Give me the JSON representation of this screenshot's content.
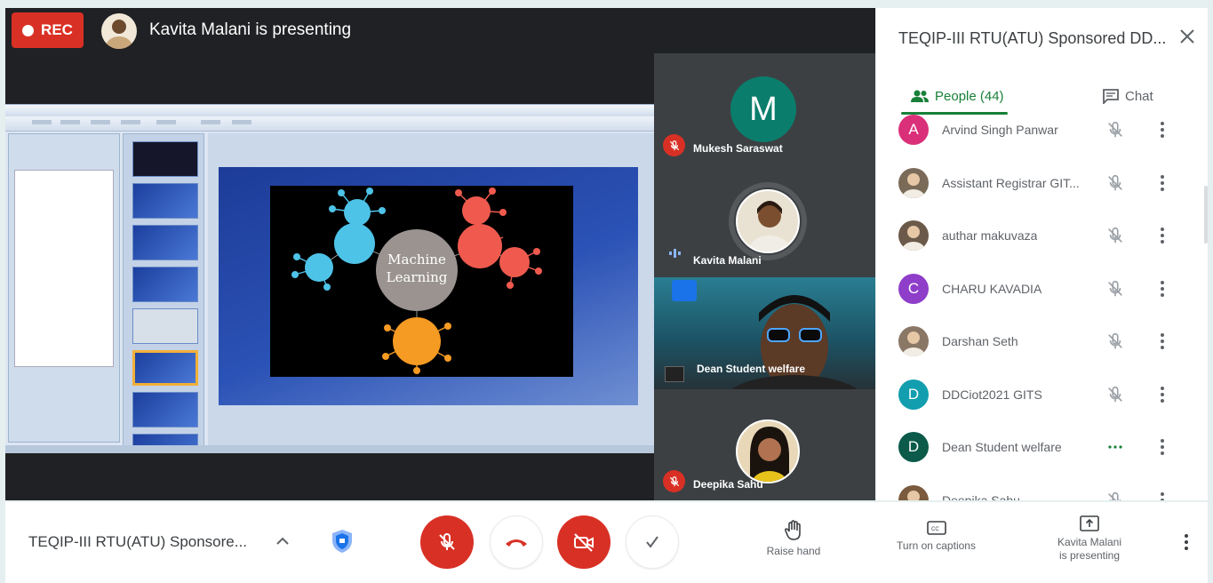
{
  "stage": {
    "rec_label": "REC",
    "presenter_banner": "Kavita Malani is presenting",
    "shared_slide_text": "Machine Learning"
  },
  "tiles": [
    {
      "name": "Mukesh Saraswat",
      "avatar_letter": "M",
      "mic": "muted"
    },
    {
      "name": "Kavita Malani",
      "mic": "speaking"
    },
    {
      "name": "Dean Student welfare",
      "mic": "video"
    },
    {
      "name": "Deepika Sahu",
      "mic": "muted"
    }
  ],
  "panel": {
    "title": "TEQIP-III RTU(ATU) Sponsored DD...",
    "tab_people": "People (44)",
    "tab_chat": "Chat",
    "people": [
      {
        "name": "Arvind Singh Panwar",
        "avatar_letter": "A",
        "avatar_color": "#d93079",
        "mic": "muted"
      },
      {
        "name": "Assistant Registrar GIT...",
        "avatar_letter": "",
        "avatar_color": "#7a6a58",
        "mic": "muted"
      },
      {
        "name": "authar makuvaza",
        "avatar_letter": "",
        "avatar_color": "#6b5a4a",
        "mic": "muted"
      },
      {
        "name": "CHARU KAVADIA",
        "avatar_letter": "C",
        "avatar_color": "#8e3ec9",
        "mic": "muted"
      },
      {
        "name": "Darshan Seth",
        "avatar_letter": "",
        "avatar_color": "#8a7766",
        "mic": "muted"
      },
      {
        "name": "DDCiot2021 GITS",
        "avatar_letter": "D",
        "avatar_color": "#129eaf",
        "mic": "muted"
      },
      {
        "name": "Dean Student welfare",
        "avatar_letter": "D",
        "avatar_color": "#0b5a4a",
        "mic": "speaking"
      },
      {
        "name": "Deepika Sahu",
        "avatar_letter": "",
        "avatar_color": "#7b5a3e",
        "mic": "muted"
      }
    ]
  },
  "bottom": {
    "meeting_name": "TEQIP-III RTU(ATU) Sponsore...",
    "raise_hand": "Raise hand",
    "captions": "Turn on captions",
    "presenting_line1": "Kavita Malani",
    "presenting_line2": "is presenting"
  },
  "colors": {
    "accent_red": "#d93025",
    "accent_green": "#188038",
    "stage_bg": "#202124"
  }
}
